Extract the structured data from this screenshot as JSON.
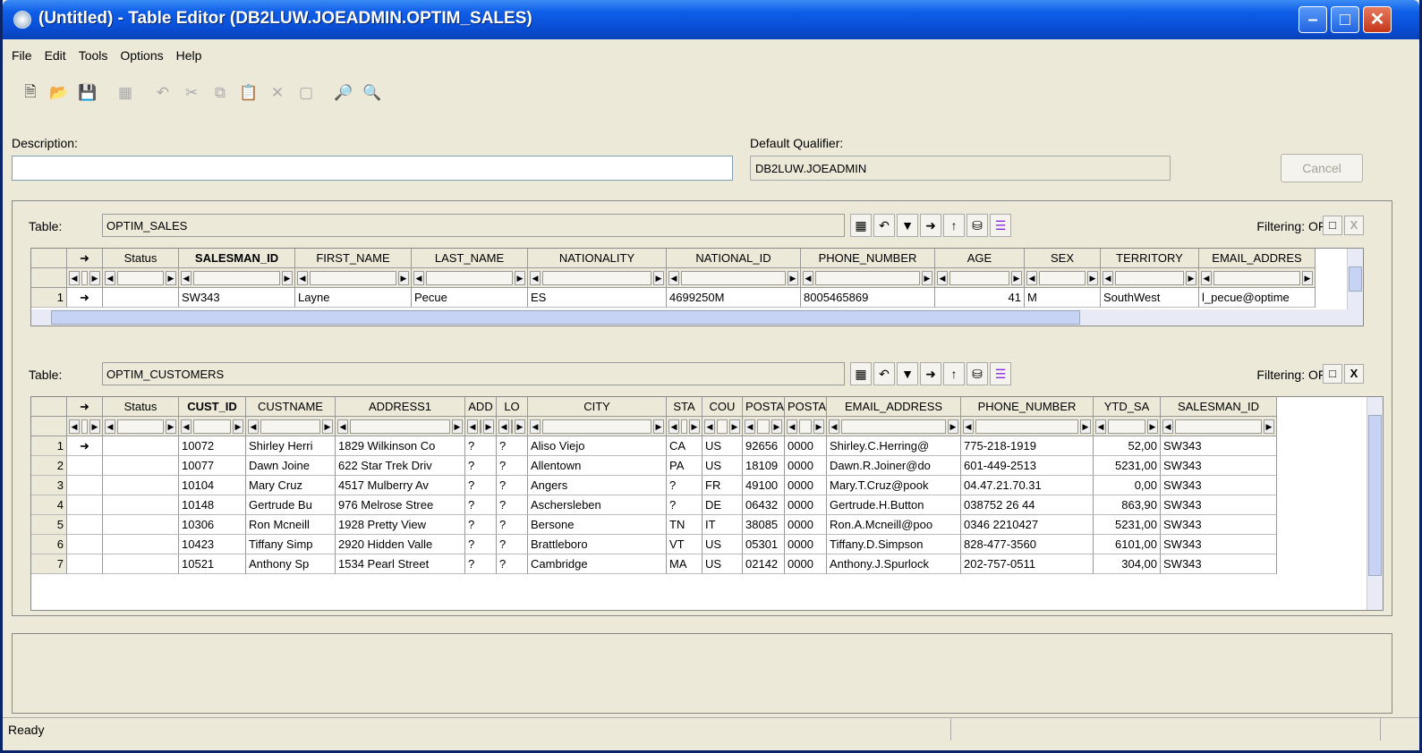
{
  "window": {
    "title": "(Untitled) - Table Editor (DB2LUW.JOEADMIN.OPTIM_SALES)"
  },
  "menu": [
    "File",
    "Edit",
    "Tools",
    "Options",
    "Help"
  ],
  "form": {
    "description_label": "Description:",
    "description_value": "",
    "qualifier_label": "Default Qualifier:",
    "qualifier_value": "DB2LUW.JOEADMIN",
    "cancel_label": "Cancel"
  },
  "sales": {
    "table_label": "Table:",
    "table_name": "OPTIM_SALES",
    "filtering": "Filtering: OFF",
    "columns": [
      "Status",
      "SALESMAN_ID",
      "FIRST_NAME",
      "LAST_NAME",
      "NATIONALITY",
      "NATIONAL_ID",
      "PHONE_NUMBER",
      "AGE",
      "SEX",
      "TERRITORY",
      "EMAIL_ADDRES"
    ],
    "rows": [
      [
        "1",
        "",
        "SW343",
        "Layne",
        "Pecue",
        "ES",
        "4699250M",
        "8005465869",
        "41",
        "M",
        "SouthWest",
        "l_pecue@optime"
      ]
    ]
  },
  "customers": {
    "table_label": "Table:",
    "table_name": "OPTIM_CUSTOMERS",
    "filtering": "Filtering: OFF",
    "columns": [
      "Status",
      "CUST_ID",
      "CUSTNAME",
      "ADDRESS1",
      "ADD",
      "LO",
      "CITY",
      "STA",
      "COU",
      "POSTA",
      "POSTA",
      "EMAIL_ADDRESS",
      "PHONE_NUMBER",
      "YTD_SA",
      "SALESMAN_ID"
    ],
    "rows": [
      [
        "1",
        "",
        "10072",
        "Shirley Herri",
        "1829 Wilkinson Co",
        "?",
        "?",
        "Aliso Viejo",
        "CA",
        "US",
        "92656",
        "0000",
        "Shirley.C.Herring@",
        "775-218-1919",
        "52,00",
        "SW343"
      ],
      [
        "2",
        "",
        "10077",
        "Dawn Joine",
        "622 Star Trek Driv",
        "?",
        "?",
        "Allentown",
        "PA",
        "US",
        "18109",
        "0000",
        "Dawn.R.Joiner@do",
        "601-449-2513",
        "5231,00",
        "SW343"
      ],
      [
        "3",
        "",
        "10104",
        "Mary Cruz",
        "4517 Mulberry Av",
        "?",
        "?",
        "Angers",
        "?",
        "FR",
        "49100",
        "0000",
        "Mary.T.Cruz@pook",
        "04.47.21.70.31",
        "0,00",
        "SW343"
      ],
      [
        "4",
        "",
        "10148",
        "Gertrude Bu",
        "976 Melrose Stree",
        "?",
        "?",
        "Aschersleben",
        "?",
        "DE",
        "06432",
        "0000",
        "Gertrude.H.Button",
        "038752 26 44",
        "863,90",
        "SW343"
      ],
      [
        "5",
        "",
        "10306",
        "Ron Mcneill",
        "1928 Pretty View",
        "?",
        "?",
        "Bersone",
        "TN",
        "IT",
        "38085",
        "0000",
        "Ron.A.Mcneill@poo",
        "0346 2210427",
        "5231,00",
        "SW343"
      ],
      [
        "6",
        "",
        "10423",
        "Tiffany Simp",
        "2920 Hidden Valle",
        "?",
        "?",
        "Brattleboro",
        "VT",
        "US",
        "05301",
        "0000",
        "Tiffany.D.Simpson",
        "828-477-3560",
        "6101,00",
        "SW343"
      ],
      [
        "7",
        "",
        "10521",
        "Anthony Sp",
        "1534 Pearl Street",
        "?",
        "?",
        "Cambridge",
        "MA",
        "US",
        "02142",
        "0000",
        "Anthony.J.Spurlock",
        "202-757-0511",
        "304,00",
        "SW343"
      ]
    ]
  },
  "status": {
    "text": "Ready"
  }
}
